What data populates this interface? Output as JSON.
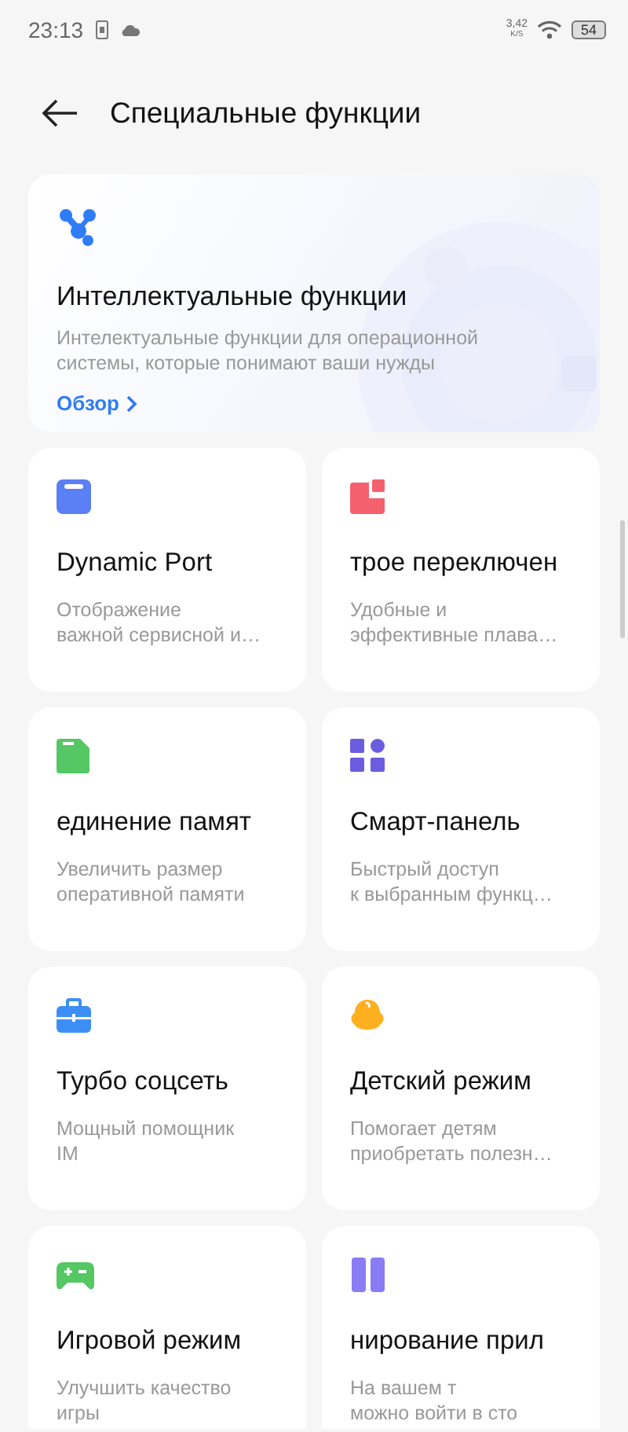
{
  "status_bar": {
    "time": "23:13",
    "speed_value": "3,42",
    "speed_unit": "K/S",
    "battery": "54"
  },
  "header": {
    "title": "Специальные функции"
  },
  "hero": {
    "title": "Интеллектуальные функции",
    "description": "Интелектуальные функции для операционной системы, которые понимают ваши нужды",
    "link": "Обзор"
  },
  "cards": [
    {
      "kind": "window",
      "color": "#5b7ff5",
      "title": "Dynamic Port",
      "desc_lines": [
        "Отображение",
        "важной сервисной и…"
      ]
    },
    {
      "kind": "squares",
      "color": "#f5606e",
      "title": "трое переключен",
      "desc_lines": [
        "Удобные и",
        "эффективные плава…"
      ]
    },
    {
      "kind": "file",
      "color": "#55c764",
      "title": "единение памят",
      "desc_lines": [
        "Увеличить размер",
        "оперативной памяти"
      ]
    },
    {
      "kind": "grid",
      "color": "#6b5ce0",
      "title": "Смарт-панель",
      "desc_lines": [
        "Быстрый доступ",
        "к выбранным функц…"
      ]
    },
    {
      "kind": "case",
      "color": "#3d8ff5",
      "title": "Турбо соцсеть",
      "desc_lines": [
        "Мощный помощник",
        "IM"
      ]
    },
    {
      "kind": "blob",
      "color": "#ffb020",
      "title": "Детский режим",
      "desc_lines": [
        "Помогает детям",
        "приобретать полезн…"
      ]
    },
    {
      "kind": "pad",
      "color": "#55c764",
      "title": "Игровой режим",
      "desc_lines": [
        "Улучшить качество",
        "игры"
      ]
    },
    {
      "kind": "split",
      "color": "#8a7cf5",
      "title": "нирование прил",
      "desc_lines": [
        "На вашем т",
        "можно войти в сто"
      ]
    }
  ]
}
